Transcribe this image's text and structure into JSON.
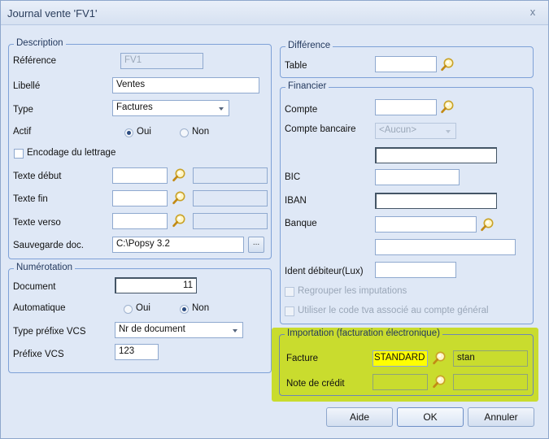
{
  "window": {
    "title": "Journal vente 'FV1'",
    "close_glyph": "x"
  },
  "description": {
    "legend": "Description",
    "reference_label": "Référence",
    "reference_value": "FV1",
    "libelle_label": "Libellé",
    "libelle_value": "Ventes",
    "type_label": "Type",
    "type_value": "Factures",
    "actif_label": "Actif",
    "actif_oui": "Oui",
    "actif_non": "Non",
    "actif_selected": "Oui",
    "encodage_label": "Encodage du lettrage",
    "texte_debut_label": "Texte début",
    "texte_fin_label": "Texte fin",
    "texte_verso_label": "Texte verso",
    "sauvegarde_label": "Sauvegarde doc.",
    "sauvegarde_value": "C:\\Popsy 3.2",
    "browse_label": "..."
  },
  "numerotation": {
    "legend": "Numérotation",
    "document_label": "Document",
    "document_value": "11",
    "automatique_label": "Automatique",
    "auto_oui": "Oui",
    "auto_non": "Non",
    "auto_selected": "Non",
    "type_prefixe_label": "Type préfixe VCS",
    "type_prefixe_value": "Nr de document",
    "prefixe_label": "Préfixe VCS",
    "prefixe_value": "123"
  },
  "difference": {
    "legend": "Différence",
    "table_label": "Table"
  },
  "financier": {
    "legend": "Financier",
    "compte_label": "Compte",
    "compte_bancaire_label": "Compte bancaire",
    "compte_bancaire_value": "<Aucun>",
    "bic_label": "BIC",
    "iban_label": "IBAN",
    "banque_label": "Banque",
    "ident_label": "Ident débiteur(Lux)",
    "regrouper_label": "Regrouper les imputations",
    "utiliser_label": "Utiliser le code tva associé au compte général"
  },
  "importation": {
    "legend": "Importation (facturation électronique)",
    "facture_label": "Facture",
    "facture_code": "STANDARD",
    "facture_desc": "stan",
    "note_label": "Note de crédit"
  },
  "buttons": {
    "aide": "Aide",
    "ok": "OK",
    "annuler": "Annuler"
  },
  "icons": {
    "search": "magnifier-icon"
  },
  "colors": {
    "highlight": "#c9dc2e",
    "yellow_field": "#ffff00",
    "border": "#7ea1d7"
  }
}
